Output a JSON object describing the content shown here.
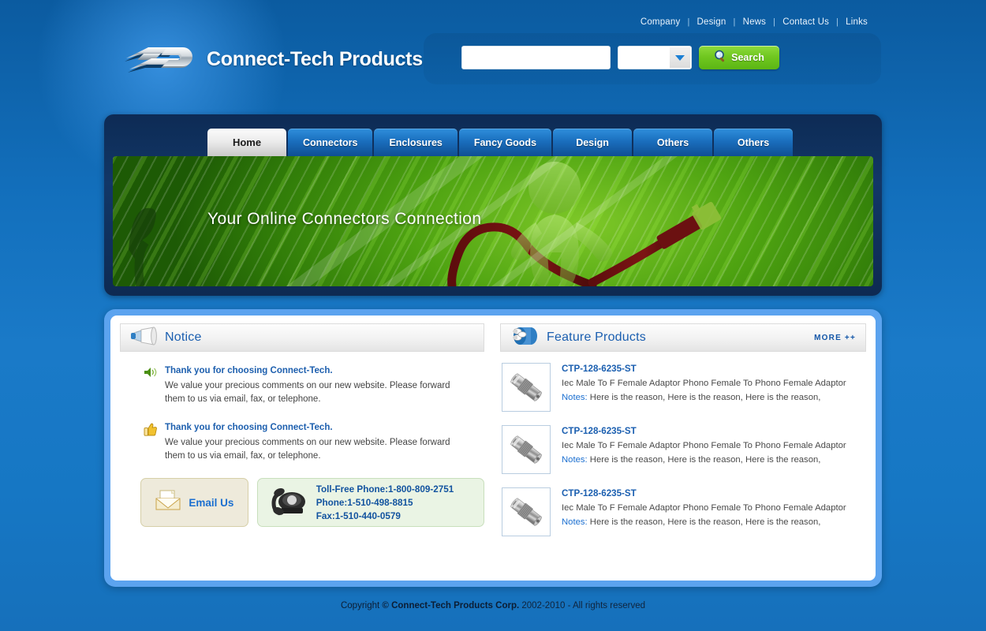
{
  "top_nav": {
    "items": [
      {
        "label": "Company"
      },
      {
        "label": "Design"
      },
      {
        "label": "News"
      },
      {
        "label": "Contact Us"
      },
      {
        "label": "Links"
      }
    ],
    "separator": "|"
  },
  "header": {
    "logo_text": "Connect-Tech Products",
    "logo_icon": "connect-tech-logo-icon"
  },
  "search": {
    "input_value": "",
    "input_placeholder": "",
    "select_value": "",
    "button_label": "Search",
    "button_icon": "magnifier-icon",
    "button_color": "#6fc61f"
  },
  "main_nav": {
    "tabs": [
      {
        "label": "Home",
        "active": true
      },
      {
        "label": "Connectors",
        "active": false
      },
      {
        "label": "Enclosures",
        "active": false
      },
      {
        "label": "Fancy Goods",
        "active": false
      },
      {
        "label": "Design",
        "active": false
      },
      {
        "label": "Others",
        "active": false
      },
      {
        "label": "Others",
        "active": false
      }
    ]
  },
  "banner": {
    "title": "Your Online Connectors Connection",
    "image_alt": "green-leaf-figure-with-cable"
  },
  "notice_panel": {
    "title": "Notice",
    "icon": "megaphone-icon",
    "items": [
      {
        "icon": "speaker-icon",
        "title": "Thank you for choosing Connect-Tech.",
        "body": "We value your precious comments on our new website. Please forward them to us via email, fax, or telephone."
      },
      {
        "icon": "thumbs-up-icon",
        "title": "Thank you for choosing Connect-Tech.",
        "body": "We value your precious comments on our new website. Please forward them to us via email, fax, or telephone."
      }
    ],
    "email_box": {
      "label": "Email Us",
      "icon": "envelope-icon"
    },
    "phone_box": {
      "icon": "telephone-icon",
      "toll_free": "Toll-Free Phone:1-800-809-2751",
      "phone": "Phone:1-510-498-8815",
      "fax": "Fax:1-510-440-0579"
    }
  },
  "feature_panel": {
    "title": "Feature Products",
    "icon": "connectors-bundle-icon",
    "more_label": "MORE ++",
    "products": [
      {
        "name": "CTP-128-6235-ST",
        "description": "Iec Male To F Female Adaptor Phono Female To Phono Female Adaptor",
        "notes_label": "Notes:",
        "notes": "Here is the reason, Here is the reason, Here is the reason,",
        "thumb_icon": "coaxial-adaptor-thumbnail"
      },
      {
        "name": "CTP-128-6235-ST",
        "description": "Iec Male To F Female Adaptor Phono Female To Phono Female Adaptor",
        "notes_label": "Notes:",
        "notes": "Here is the reason, Here is the reason, Here is the reason,",
        "thumb_icon": "coaxial-adaptor-thumbnail"
      },
      {
        "name": "CTP-128-6235-ST",
        "description": "Iec Male To F Female Adaptor Phono Female To Phono Female Adaptor",
        "notes_label": "Notes:",
        "notes": "Here is the reason, Here is the reason, Here is the reason,",
        "thumb_icon": "coaxial-adaptor-thumbnail"
      }
    ]
  },
  "footer": {
    "copyright_prefix": "Copyright",
    "copyright_symbol": "©",
    "company": "Connect-Tech Products Corp.",
    "years": "2002-2010 - All rights reserved"
  }
}
